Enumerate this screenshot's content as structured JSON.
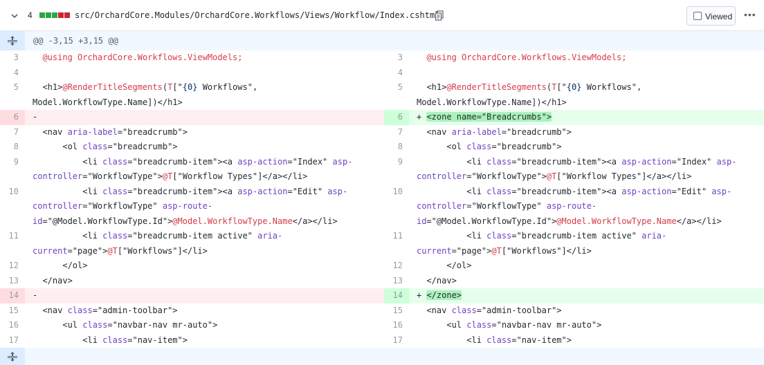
{
  "header": {
    "changes_count": "4",
    "stat_blocks": [
      "added",
      "added",
      "added",
      "deleted",
      "deleted"
    ],
    "file_path": "src/OrchardCore.Modules/OrchardCore.Workflows/Views/Workflow/Index.cshtml",
    "viewed_label": "Viewed",
    "more_label": "•••"
  },
  "hunk": {
    "header": "@@ -3,15 +3,15 @@"
  },
  "colors": {
    "added_bg": "#e6ffed",
    "added_num_bg": "#cdffd8",
    "deleted_bg": "#ffeef0",
    "deleted_num_bg": "#ffdce0",
    "expander_bg": "#dbedff",
    "hunk_bg": "#f1f8ff",
    "stat_added": "#28a745",
    "stat_deleted": "#cb2431"
  },
  "left": [
    {
      "num": "3",
      "type": "context",
      "segs": [
        [
          "  ",
          ""
        ],
        [
          "@using ",
          "kw"
        ],
        [
          "OrchardCore.Workflows.ViewModels;",
          "kw"
        ]
      ]
    },
    {
      "num": "4",
      "type": "context",
      "segs": []
    },
    {
      "num": "5",
      "type": "context",
      "segs": [
        [
          "  <h1>",
          ""
        ],
        [
          "@RenderTitleSegments",
          "kw"
        ],
        [
          "(",
          ""
        ],
        [
          "T",
          "kw"
        ],
        [
          "[\"",
          ""
        ],
        [
          "{0}",
          "str"
        ],
        [
          " Workflows\",",
          ""
        ]
      ]
    },
    {
      "num": "",
      "type": "context",
      "segs": [
        [
          "Model.WorkflowType.Name])</h1>",
          ""
        ]
      ]
    },
    {
      "num": "6",
      "type": "deleted",
      "segs": [
        [
          "-",
          ""
        ]
      ]
    },
    {
      "num": "7",
      "type": "context",
      "segs": [
        [
          "  <nav ",
          ""
        ],
        [
          "aria-label",
          "at"
        ],
        [
          "=\"breadcrumb\">",
          ""
        ]
      ]
    },
    {
      "num": "8",
      "type": "context",
      "segs": [
        [
          "      <ol ",
          ""
        ],
        [
          "class",
          "at"
        ],
        [
          "=\"breadcrumb\">",
          ""
        ]
      ]
    },
    {
      "num": "9",
      "type": "context",
      "segs": [
        [
          "          <li ",
          ""
        ],
        [
          "class",
          "at"
        ],
        [
          "=\"breadcrumb-item\"><a ",
          ""
        ],
        [
          "asp-action",
          "at"
        ],
        [
          "=\"Index\" ",
          ""
        ],
        [
          "asp-",
          "at"
        ]
      ]
    },
    {
      "num": "",
      "type": "context",
      "segs": [
        [
          "controller",
          "at"
        ],
        [
          "=\"WorkflowType\">",
          ""
        ],
        [
          "@T",
          "kw"
        ],
        [
          "[\"Workflow Types\"]</a></li>",
          ""
        ]
      ]
    },
    {
      "num": "10",
      "type": "context",
      "segs": [
        [
          "          <li ",
          ""
        ],
        [
          "class",
          "at"
        ],
        [
          "=\"breadcrumb-item\"><a ",
          ""
        ],
        [
          "asp-action",
          "at"
        ],
        [
          "=\"Edit\" ",
          ""
        ],
        [
          "asp-",
          "at"
        ]
      ]
    },
    {
      "num": "",
      "type": "context",
      "segs": [
        [
          "controller",
          "at"
        ],
        [
          "=\"WorkflowType\" ",
          ""
        ],
        [
          "asp-route-",
          "at"
        ]
      ]
    },
    {
      "num": "",
      "type": "context",
      "segs": [
        [
          "id",
          "at"
        ],
        [
          "=\"@Model.WorkflowType.Id\">",
          ""
        ],
        [
          "@Model.WorkflowType.Name",
          "kw"
        ],
        [
          "</a></li>",
          ""
        ]
      ]
    },
    {
      "num": "11",
      "type": "context",
      "segs": [
        [
          "          <li ",
          ""
        ],
        [
          "class",
          "at"
        ],
        [
          "=\"breadcrumb-item active\" ",
          ""
        ],
        [
          "aria-",
          "at"
        ]
      ]
    },
    {
      "num": "",
      "type": "context",
      "segs": [
        [
          "current",
          "at"
        ],
        [
          "=\"page\">",
          ""
        ],
        [
          "@T",
          "kw"
        ],
        [
          "[\"Workflows\"]</li>",
          ""
        ]
      ]
    },
    {
      "num": "12",
      "type": "context",
      "segs": [
        [
          "      </ol>",
          ""
        ]
      ]
    },
    {
      "num": "13",
      "type": "context",
      "segs": [
        [
          "  </nav>",
          ""
        ]
      ]
    },
    {
      "num": "14",
      "type": "deleted",
      "segs": [
        [
          "-",
          ""
        ]
      ]
    },
    {
      "num": "15",
      "type": "context",
      "segs": [
        [
          "  <nav ",
          ""
        ],
        [
          "class",
          "at"
        ],
        [
          "=\"admin-toolbar\">",
          ""
        ]
      ]
    },
    {
      "num": "16",
      "type": "context",
      "segs": [
        [
          "      <ul ",
          ""
        ],
        [
          "class",
          "at"
        ],
        [
          "=\"navbar-nav mr-auto\">",
          ""
        ]
      ]
    },
    {
      "num": "17",
      "type": "context",
      "segs": [
        [
          "          <li ",
          ""
        ],
        [
          "class",
          "at"
        ],
        [
          "=\"nav-item\">",
          ""
        ]
      ]
    }
  ],
  "right": [
    {
      "num": "3",
      "type": "context",
      "segs": [
        [
          "  ",
          ""
        ],
        [
          "@using ",
          "kw"
        ],
        [
          "OrchardCore.Workflows.ViewModels;",
          "kw"
        ]
      ]
    },
    {
      "num": "4",
      "type": "context",
      "segs": []
    },
    {
      "num": "5",
      "type": "context",
      "segs": [
        [
          "  <h1>",
          ""
        ],
        [
          "@RenderTitleSegments",
          "kw"
        ],
        [
          "(",
          ""
        ],
        [
          "T",
          "kw"
        ],
        [
          "[\"",
          ""
        ],
        [
          "{0}",
          "str"
        ],
        [
          " Workflows\",",
          ""
        ]
      ]
    },
    {
      "num": "",
      "type": "context",
      "segs": [
        [
          "Model.WorkflowType.Name])</h1>",
          ""
        ]
      ]
    },
    {
      "num": "6",
      "type": "added",
      "segs": [
        [
          "+ ",
          ""
        ],
        [
          "<zone name=\"Breadcrumbs\">",
          "hl"
        ]
      ]
    },
    {
      "num": "7",
      "type": "context",
      "segs": [
        [
          "  <nav ",
          ""
        ],
        [
          "aria-label",
          "at"
        ],
        [
          "=\"breadcrumb\">",
          ""
        ]
      ]
    },
    {
      "num": "8",
      "type": "context",
      "segs": [
        [
          "      <ol ",
          ""
        ],
        [
          "class",
          "at"
        ],
        [
          "=\"breadcrumb\">",
          ""
        ]
      ]
    },
    {
      "num": "9",
      "type": "context",
      "segs": [
        [
          "          <li ",
          ""
        ],
        [
          "class",
          "at"
        ],
        [
          "=\"breadcrumb-item\"><a ",
          ""
        ],
        [
          "asp-action",
          "at"
        ],
        [
          "=\"Index\" ",
          ""
        ],
        [
          "asp-",
          "at"
        ]
      ]
    },
    {
      "num": "",
      "type": "context",
      "segs": [
        [
          "controller",
          "at"
        ],
        [
          "=\"WorkflowType\">",
          ""
        ],
        [
          "@T",
          "kw"
        ],
        [
          "[\"Workflow Types\"]</a></li>",
          ""
        ]
      ]
    },
    {
      "num": "10",
      "type": "context",
      "segs": [
        [
          "          <li ",
          ""
        ],
        [
          "class",
          "at"
        ],
        [
          "=\"breadcrumb-item\"><a ",
          ""
        ],
        [
          "asp-action",
          "at"
        ],
        [
          "=\"Edit\" ",
          ""
        ],
        [
          "asp-",
          "at"
        ]
      ]
    },
    {
      "num": "",
      "type": "context",
      "segs": [
        [
          "controller",
          "at"
        ],
        [
          "=\"WorkflowType\" ",
          ""
        ],
        [
          "asp-route-",
          "at"
        ]
      ]
    },
    {
      "num": "",
      "type": "context",
      "segs": [
        [
          "id",
          "at"
        ],
        [
          "=\"@Model.WorkflowType.Id\">",
          ""
        ],
        [
          "@Model.WorkflowType.Name",
          "kw"
        ],
        [
          "</a></li>",
          ""
        ]
      ]
    },
    {
      "num": "11",
      "type": "context",
      "segs": [
        [
          "          <li ",
          ""
        ],
        [
          "class",
          "at"
        ],
        [
          "=\"breadcrumb-item active\" ",
          ""
        ],
        [
          "aria-",
          "at"
        ]
      ]
    },
    {
      "num": "",
      "type": "context",
      "segs": [
        [
          "current",
          "at"
        ],
        [
          "=\"page\">",
          ""
        ],
        [
          "@T",
          "kw"
        ],
        [
          "[\"Workflows\"]</li>",
          ""
        ]
      ]
    },
    {
      "num": "12",
      "type": "context",
      "segs": [
        [
          "      </ol>",
          ""
        ]
      ]
    },
    {
      "num": "13",
      "type": "context",
      "segs": [
        [
          "  </nav>",
          ""
        ]
      ]
    },
    {
      "num": "14",
      "type": "added",
      "segs": [
        [
          "+ ",
          ""
        ],
        [
          "</zone>",
          "hl"
        ]
      ]
    },
    {
      "num": "15",
      "type": "context",
      "segs": [
        [
          "  <nav ",
          ""
        ],
        [
          "class",
          "at"
        ],
        [
          "=\"admin-toolbar\">",
          ""
        ]
      ]
    },
    {
      "num": "16",
      "type": "context",
      "segs": [
        [
          "      <ul ",
          ""
        ],
        [
          "class",
          "at"
        ],
        [
          "=\"navbar-nav mr-auto\">",
          ""
        ]
      ]
    },
    {
      "num": "17",
      "type": "context",
      "segs": [
        [
          "          <li ",
          ""
        ],
        [
          "class",
          "at"
        ],
        [
          "=\"nav-item\">",
          ""
        ]
      ]
    }
  ]
}
